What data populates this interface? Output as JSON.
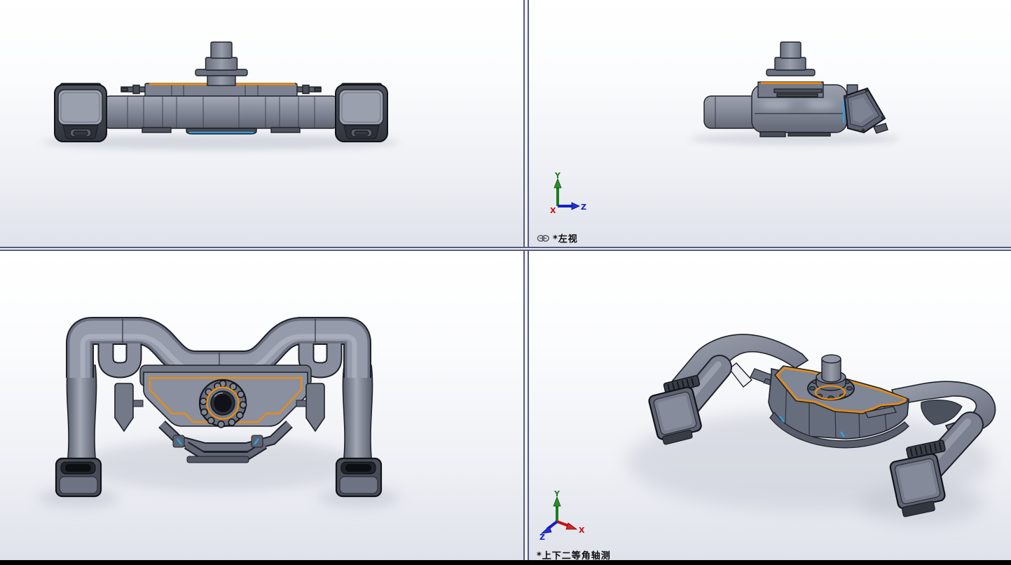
{
  "viewports": {
    "top_left": {
      "content": "front orthographic view of part"
    },
    "top_right": {
      "label": "*左视",
      "link_icon": "link-icon",
      "triad": {
        "up": "Y",
        "right": "Z",
        "origin": "X"
      }
    },
    "bottom_left": {
      "content": "top orthographic view of part"
    },
    "bottom_right": {
      "label": "*上下二等角轴测",
      "triad": {
        "up": "Y",
        "lower_right": "X",
        "lower_left": "Z"
      }
    }
  },
  "part": {
    "body_gray": "#8a909f",
    "dark_gray": "#4a4f59",
    "edge_color": "#1d2026",
    "selection_orange": "#ef8c08",
    "accent_blue": "#2fa2e8"
  },
  "axis_colors": {
    "x": "#c01414",
    "y": "#1c7d1c",
    "z": "#1420c8"
  },
  "chrome": {
    "divider_color": "#565c7e",
    "bottom_bar_color": "#000000",
    "viewport_bg_top": "#ffffff",
    "viewport_bg_bottom": "#dfe2ea"
  }
}
